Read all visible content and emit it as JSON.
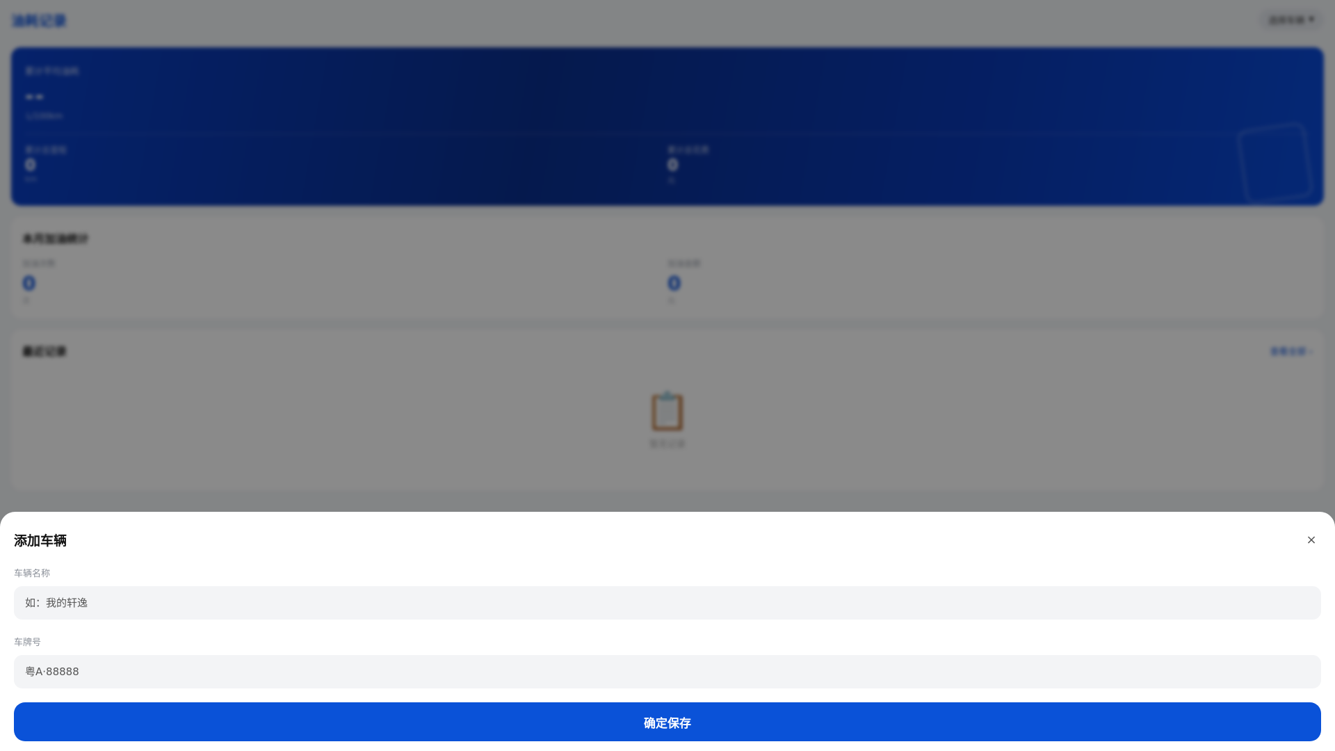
{
  "header": {
    "title": "油耗记录",
    "vehicle_select": "选择车辆",
    "caret_icon": "caret-down-icon"
  },
  "summary": {
    "avg_label": "累计平均油耗",
    "avg_value": "--",
    "avg_unit": "L/100km",
    "mileage_label": "累计总里程",
    "mileage_value": "0",
    "mileage_unit": "km",
    "cost_label": "累计总花费",
    "cost_value": "0",
    "cost_unit": "元"
  },
  "month": {
    "title": "本月加油统计",
    "count_label": "加油次数",
    "count_value": "0",
    "count_unit": "次",
    "amount_label": "加油金额",
    "amount_value": "0",
    "amount_unit": "元"
  },
  "recent": {
    "title": "最近记录",
    "view_all": "查看全部 ›",
    "empty_icon": "📋",
    "empty_text": "暂无记录"
  },
  "sheet": {
    "title": "添加车辆",
    "close_icon": "×",
    "name_label": "车辆名称",
    "name_placeholder": "如：我的轩逸",
    "plate_label": "车牌号",
    "plate_placeholder": "粤A·88888",
    "save_label": "确定保存"
  },
  "colors": {
    "primary": "#0a52d8",
    "title_blue": "#0a4fd6"
  }
}
